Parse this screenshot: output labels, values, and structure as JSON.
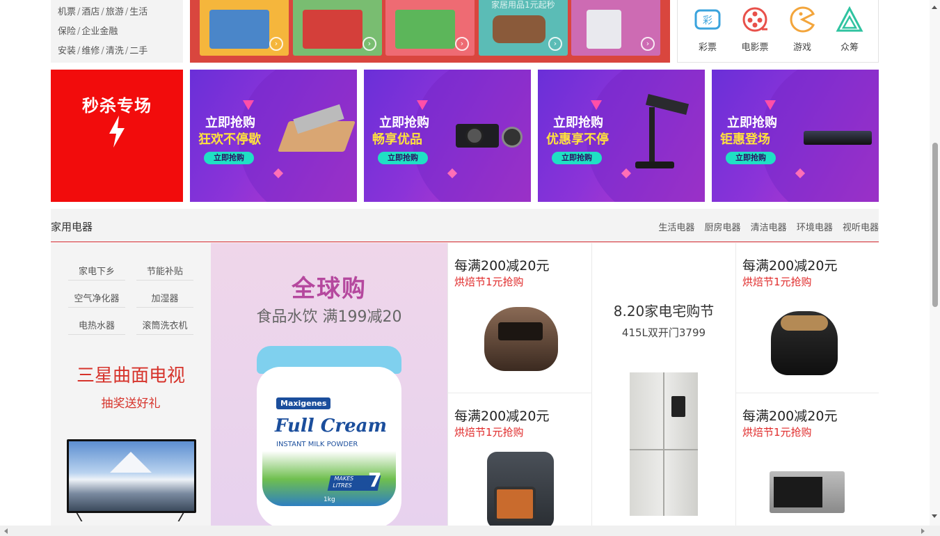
{
  "left_services": {
    "rows": [
      [
        "机票",
        "酒店",
        "旅游",
        "生活"
      ],
      [
        "保险",
        "企业金融"
      ],
      [
        "安装",
        "维修",
        "清洗",
        "二手"
      ]
    ],
    "separator": "/"
  },
  "top_banner": {
    "tiles": [
      {
        "color": "#f5b63c",
        "prod": "#4a86c9"
      },
      {
        "color": "#79bd71",
        "prod": "#d43f3a"
      },
      {
        "color": "#ee6b73",
        "prod": "#5cb65a"
      },
      {
        "color": "#5bbcb6",
        "prod": "#8a5a3a",
        "caption": "家居用品1元起秒"
      },
      {
        "color": "#cd6bb3",
        "prod": "#e9e9ee"
      }
    ],
    "go_icon": "›"
  },
  "services": [
    {
      "label": "彩票",
      "icon": "lottery-icon"
    },
    {
      "label": "电影票",
      "icon": "film-reel-icon"
    },
    {
      "label": "游戏",
      "icon": "pacman-icon"
    },
    {
      "label": "众筹",
      "icon": "crowdfund-triangle-icon"
    }
  ],
  "seckill": {
    "title": "秒杀专场"
  },
  "promos": [
    {
      "line1": "立即抢购",
      "line2": "狂欢不停歇",
      "button": "立即抢购"
    },
    {
      "line1": "立即抢购",
      "line2": "畅享优品",
      "button": "立即抢购"
    },
    {
      "line1": "立即抢购",
      "line2": "优惠享不停",
      "button": "立即抢购"
    },
    {
      "line1": "立即抢购",
      "line2": "钜惠登场",
      "button": "立即抢购"
    }
  ],
  "floor": {
    "title": "家用电器",
    "links": [
      "生活电器",
      "厨房电器",
      "清洁电器",
      "环境电器",
      "视听电器"
    ],
    "keywords": [
      "家电下乡",
      "节能补贴",
      "空气净化器",
      "加湿器",
      "电热水器",
      "滚筒洗衣机"
    ],
    "tv": {
      "title": "三星曲面电视",
      "sub": "抽奖送好礼"
    },
    "global": {
      "title": "全球购",
      "sub": "食品水饮  满199减20",
      "brand": "Maxigenes",
      "product": "Full Cream",
      "product_sub": "INSTANT MILK POWDER",
      "makes": "MAKES",
      "litres": "LITRES",
      "qty": "7",
      "weight": "1kg"
    },
    "cells": [
      {
        "line1": "每满200减20元",
        "line2": "烘焙节1元抢购"
      },
      {
        "line1": "每满200减20元",
        "line2": "烘焙节1元抢购"
      },
      {
        "line1": "每满200减20元",
        "line2": "烘焙节1元抢购"
      },
      {
        "line1": "每满200减20元",
        "line2": "烘焙节1元抢购"
      }
    ],
    "featured": {
      "line1": "8.20家电宅购节",
      "line2": "415L双开门3799"
    }
  }
}
